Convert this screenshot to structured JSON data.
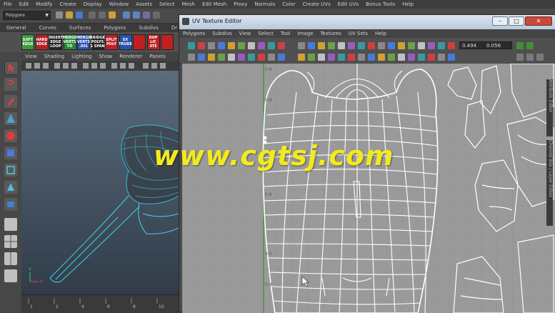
{
  "main_menu": [
    "File",
    "Edit",
    "Modify",
    "Create",
    "Display",
    "Window",
    "Assets",
    "Select",
    "Mesh",
    "Edit Mesh",
    "Proxy",
    "Normals",
    "Color",
    "Create UVs",
    "Edit UVs",
    "Bonus Tools",
    "Help"
  ],
  "status_line": {
    "mode": "Polygons"
  },
  "shelf": {
    "tabs": [
      "General",
      "Curves",
      "Surfaces",
      "Polygons",
      "Subdivs",
      "Dr"
    ],
    "buttons": [
      {
        "label": "SOFT EDGE",
        "color": "#3c9a3c"
      },
      {
        "label": "HARD EDGE",
        "color": "#b8202a"
      },
      {
        "label": "INSERT EDGE LOOP",
        "color": "#222222"
      },
      {
        "label": "MERGE VERTS TO",
        "color": "#2a8a3a"
      },
      {
        "label": "MERGE VERTS .001",
        "color": "#2a52b0"
      },
      {
        "label": "BRIDGE POLYS 1 SPAN",
        "color": "#222222"
      },
      {
        "label": "SPLIT POLY",
        "color": "#c0202a"
      },
      {
        "label": "EX TRUDE",
        "color": "#2a52b0"
      },
      {
        "label": "",
        "color": "#c02020"
      },
      {
        "label": "DUP LIC ATE",
        "color": "#c02020"
      },
      {
        "label": "",
        "color": "#c02020"
      }
    ]
  },
  "viewport": {
    "menu": [
      "View",
      "Shading",
      "Lighting",
      "Show",
      "Renderer",
      "Panels"
    ],
    "timeline_ticks": [
      "1",
      "2",
      "4",
      "6",
      "8",
      "10"
    ]
  },
  "uv_editor": {
    "title": "UV Texture Editor",
    "menu": [
      "Polygons",
      "Subdivs",
      "View",
      "Select",
      "Tool",
      "Image",
      "Textures",
      "UV Sets",
      "Help"
    ],
    "u_value": "0.494",
    "v_value": "0.056",
    "axis_labels": [
      "0.9",
      "0.8",
      "0.6",
      "0.5",
      "0.4"
    ],
    "dock_tabs": [
      "Attribute Editor",
      "Channel Box / Layer Editor"
    ]
  },
  "watermark": "www.cgtsj.com"
}
